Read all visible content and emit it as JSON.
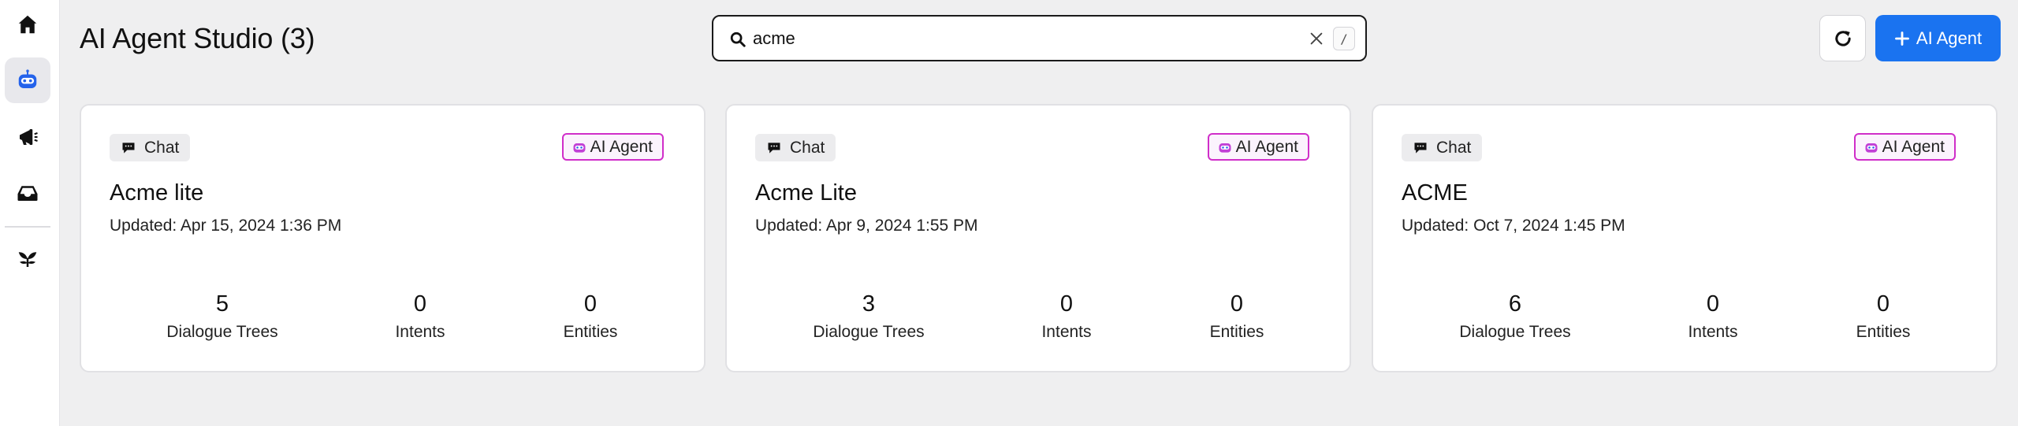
{
  "sidebar": {
    "items": [
      {
        "icon": "home-icon"
      },
      {
        "icon": "bot-icon",
        "active": true
      },
      {
        "icon": "megaphone-icon"
      },
      {
        "icon": "inbox-icon"
      },
      {
        "icon": "sprout-icon"
      }
    ]
  },
  "header": {
    "title": "AI Agent Studio (3)",
    "search_value": "acme",
    "search_shortcut": "/",
    "primary_button_label": "AI Agent"
  },
  "cards": [
    {
      "channel": "Chat",
      "badge": "AI Agent",
      "title": "Acme lite",
      "updated": "Updated: Apr 15, 2024 1:36 PM",
      "stats": [
        {
          "value": "5",
          "label": "Dialogue Trees"
        },
        {
          "value": "0",
          "label": "Intents"
        },
        {
          "value": "0",
          "label": "Entities"
        }
      ]
    },
    {
      "channel": "Chat",
      "badge": "AI Agent",
      "title": "Acme Lite",
      "updated": "Updated: Apr 9, 2024 1:55 PM",
      "stats": [
        {
          "value": "3",
          "label": "Dialogue Trees"
        },
        {
          "value": "0",
          "label": "Intents"
        },
        {
          "value": "0",
          "label": "Entities"
        }
      ]
    },
    {
      "channel": "Chat",
      "badge": "AI Agent",
      "title": "ACME",
      "updated": "Updated: Oct 7, 2024 1:45 PM",
      "stats": [
        {
          "value": "6",
          "label": "Dialogue Trees"
        },
        {
          "value": "0",
          "label": "Intents"
        },
        {
          "value": "0",
          "label": "Entities"
        }
      ]
    }
  ],
  "colors": {
    "accent": "#1a73f0",
    "agent_badge_border": "#d02ec9",
    "background": "#efeff0"
  }
}
